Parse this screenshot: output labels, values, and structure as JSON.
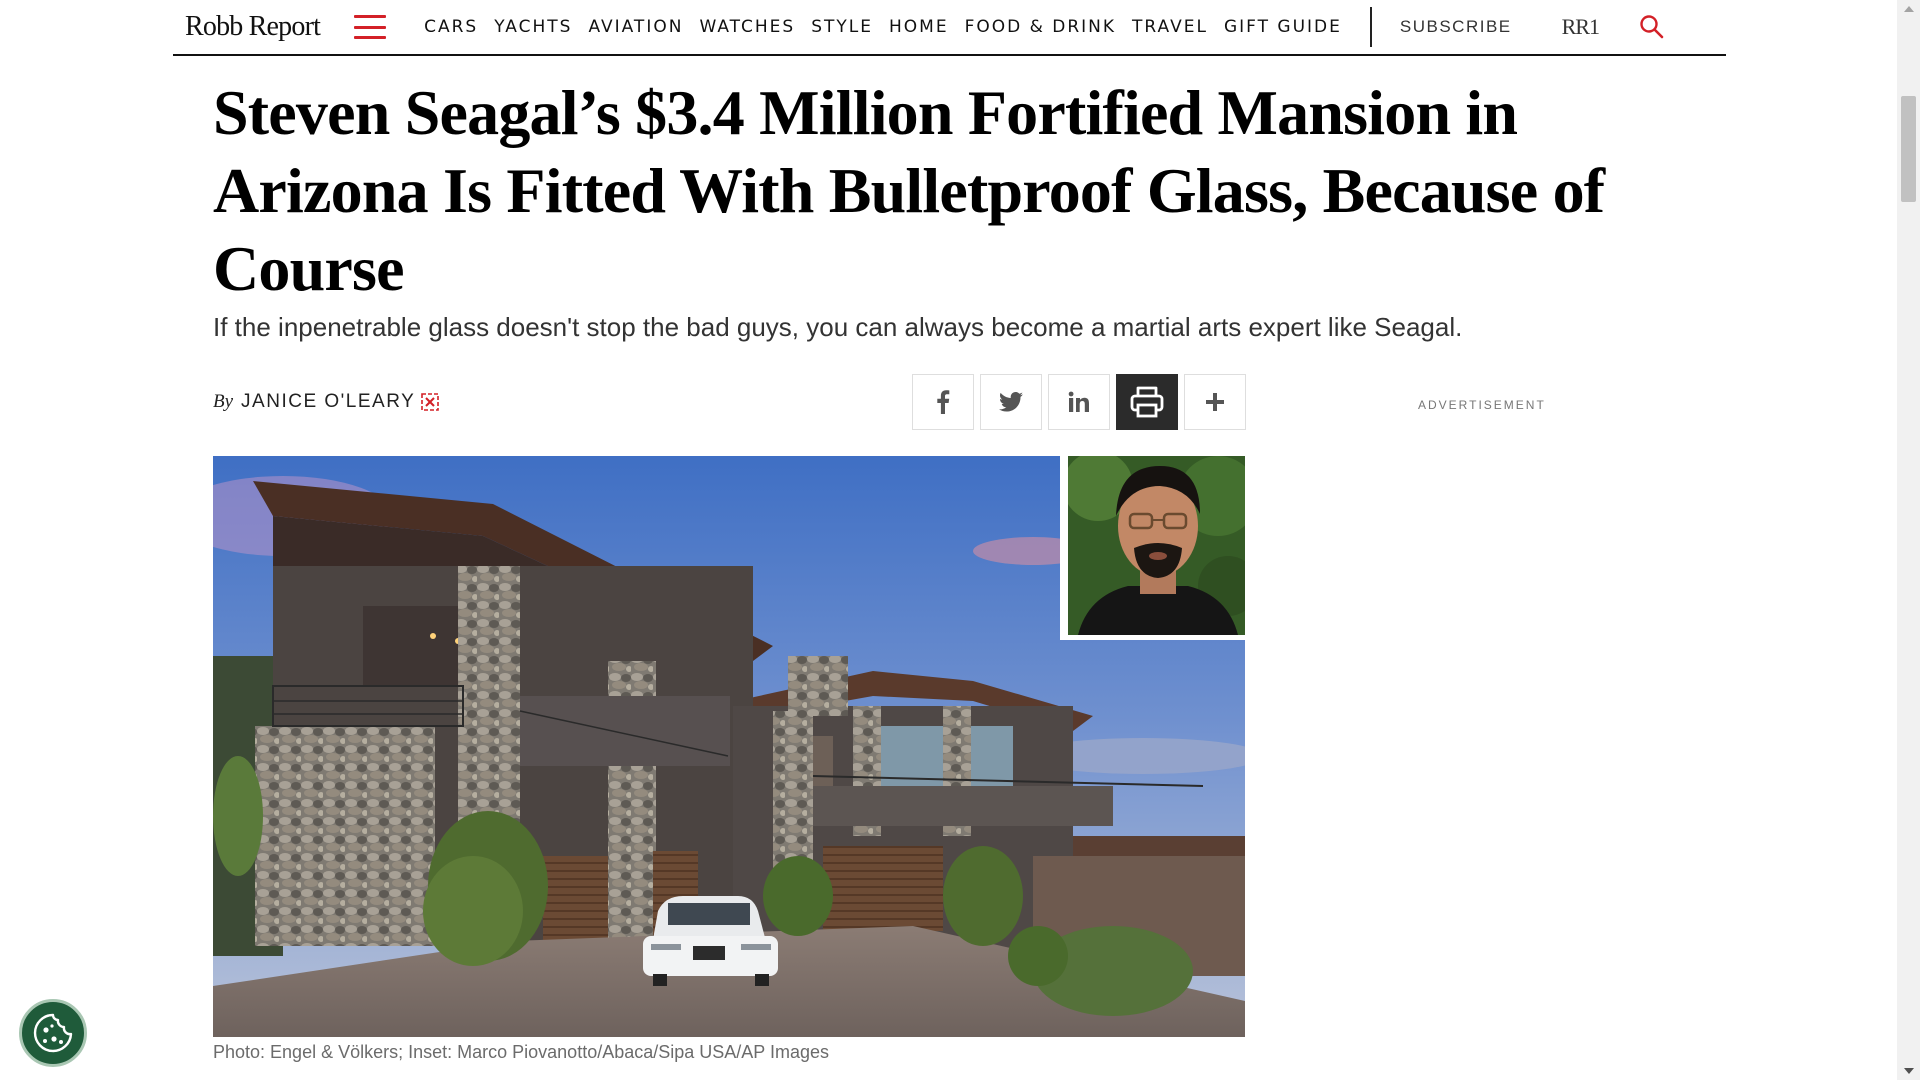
{
  "header": {
    "logo": "Robb Report",
    "nav": [
      "CARS",
      "YACHTS",
      "AVIATION",
      "WATCHES",
      "STYLE",
      "HOME",
      "FOOD & DRINK",
      "TRAVEL",
      "GIFT GUIDE"
    ],
    "subscribe": "SUBSCRIBE",
    "rr1": "RR1",
    "accent_color": "#d32027"
  },
  "article": {
    "headline": "Steven Seagal’s $3.4 Million Fortified Mansion in Arizona Is Fitted With Bulletproof Glass, Because of Course",
    "dek": "If the inpenetrable glass doesn't stop the bad guys, you can always become a martial arts expert like Seagal.",
    "byline_prefix": "By",
    "author": "JANICE O'LEARY",
    "caption": "Photo: Engel & Völkers; Inset: Marco Piovanotto/Abaca/Sipa USA/AP Images"
  },
  "share": {
    "buttons": [
      "facebook-icon",
      "twitter-icon",
      "linkedin-icon",
      "print-icon",
      "plus-icon"
    ],
    "active": "print-icon"
  },
  "ad": {
    "label": "ADVERTISEMENT"
  },
  "cookie": {
    "icon": "cookie-icon",
    "color": "#1f5b3a"
  }
}
